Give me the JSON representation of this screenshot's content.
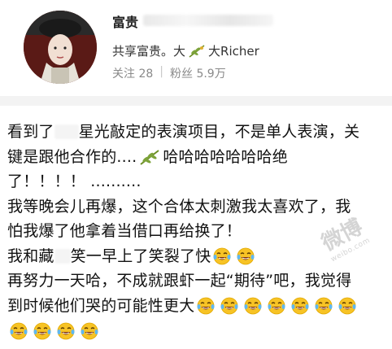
{
  "profile": {
    "name": "富贵",
    "bio_prefix": "共享富贵。大",
    "bio_suffix": "大Richer",
    "bio_icon": "olive-branch-icon",
    "follow_label": "关注",
    "follow_count": "28",
    "fans_label": "粉丝",
    "fans_count": "5.9万"
  },
  "post": {
    "line1_a": "看到了",
    "line1_b": "星光敲定的表演项目，不是单人表演，关",
    "line2_a": "键是跟他合作的....",
    "line2_b": "哈哈哈哈哈哈哈绝",
    "line3": "了！！！！ ..........",
    "line4": "我等晚会儿再爆，这个合体太刺激我太喜欢了，我",
    "line5": "怕我爆了他拿着当借口再给换了！",
    "line6_a": "我和藏",
    "line6_b": "笑一早上了笑裂了快",
    "line7": "再努力一天哈，不成就跟虾一起“期待”吧，我觉得",
    "line8": "到时候他们哭的可能性更大"
  },
  "watermark": {
    "text": "微博",
    "sub": "weibo.com"
  },
  "emoji": {
    "laugh": "laugh-cry-emoji",
    "olive": "olive-branch-emoji"
  }
}
